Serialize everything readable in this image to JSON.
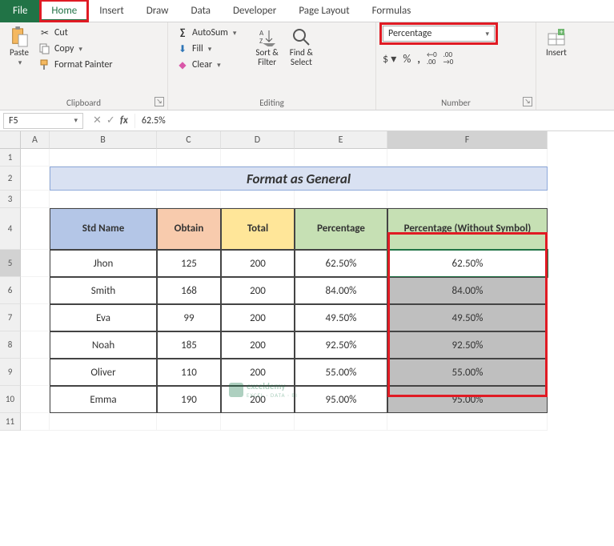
{
  "tabs": {
    "file": "File",
    "home": "Home",
    "insert": "Insert",
    "draw": "Draw",
    "data": "Data",
    "developer": "Developer",
    "page_layout": "Page Layout",
    "formulas": "Formulas"
  },
  "ribbon": {
    "clipboard": {
      "label": "Clipboard",
      "paste": "Paste",
      "cut": "Cut",
      "copy": "Copy",
      "format_painter": "Format Painter"
    },
    "editing": {
      "label": "Editing",
      "autosum": "AutoSum",
      "fill": "Fill",
      "clear": "Clear",
      "sort_filter": "Sort &\nFilter",
      "find_select": "Find &\nSelect"
    },
    "number": {
      "label": "Number",
      "format": "Percentage",
      "accounting": "$",
      "percent": "%",
      "comma": ",",
      "inc_dec": "←0\n.00",
      "dec_dec": ".00\n→0"
    },
    "cells": {
      "insert": "Insert"
    }
  },
  "formula_bar": {
    "name_box": "F5",
    "formula": "62.5%"
  },
  "columns": [
    "A",
    "B",
    "C",
    "D",
    "E",
    "F"
  ],
  "rows": [
    "1",
    "2",
    "3",
    "4",
    "5",
    "6",
    "7",
    "8",
    "9",
    "10",
    "11"
  ],
  "title": "Format as General",
  "headers": {
    "std_name": "Std Name",
    "obtain": "Obtain",
    "total": "Total",
    "percentage": "Percentage",
    "pct_no_symbol": "Percentage (Without Symbol)"
  },
  "data": [
    {
      "name": "Jhon",
      "obtain": "125",
      "total": "200",
      "pct": "62.50%",
      "pct2": "62.50%"
    },
    {
      "name": "Smith",
      "obtain": "168",
      "total": "200",
      "pct": "84.00%",
      "pct2": "84.00%"
    },
    {
      "name": "Eva",
      "obtain": "99",
      "total": "200",
      "pct": "49.50%",
      "pct2": "49.50%"
    },
    {
      "name": "Noah",
      "obtain": "185",
      "total": "200",
      "pct": "92.50%",
      "pct2": "92.50%"
    },
    {
      "name": "Oliver",
      "obtain": "110",
      "total": "200",
      "pct": "55.00%",
      "pct2": "55.00%"
    },
    {
      "name": "Emma",
      "obtain": "190",
      "total": "200",
      "pct": "95.00%",
      "pct2": "95.00%"
    }
  ],
  "watermark": {
    "brand": "exceldemy",
    "tagline": "EXCEL · DATA · BI"
  }
}
